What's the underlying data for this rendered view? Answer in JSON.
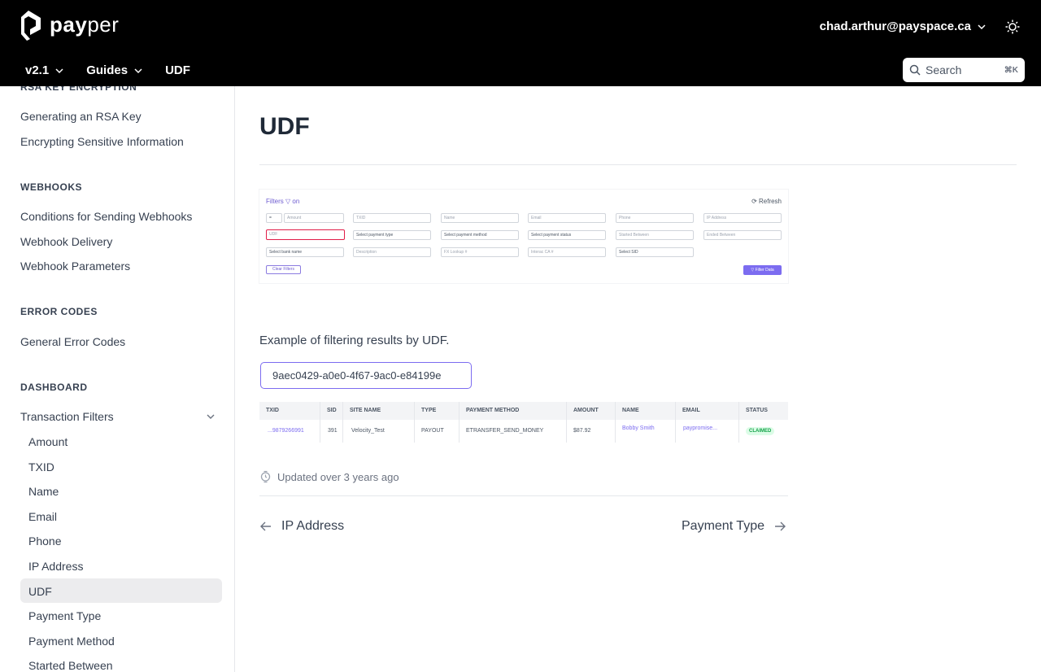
{
  "header": {
    "logo_text_bold": "pay",
    "logo_text_light": "per",
    "user_email": "chad.arthur@payspace.ca",
    "nav": [
      {
        "label": "v2.1"
      },
      {
        "label": "Guides"
      },
      {
        "label": "UDF"
      }
    ],
    "search_placeholder": "Search",
    "search_shortcut": "⌘K"
  },
  "sidebar": {
    "cut_section": "RSA KEY ENCRYPTION",
    "rsa_items": [
      "Generating an RSA Key",
      "Encrypting Sensitive Information"
    ],
    "webhooks_title": "WEBHOOKS",
    "webhooks_items": [
      "Conditions for Sending Webhooks",
      "Webhook Delivery",
      "Webhook Parameters"
    ],
    "errors_title": "ERROR CODES",
    "errors_items": [
      "General Error Codes"
    ],
    "dashboard_title": "DASHBOARD",
    "dashboard_group": "Transaction Filters",
    "filter_items": [
      "Amount",
      "TXID",
      "Name",
      "Email",
      "Phone",
      "IP Address",
      "UDF",
      "Payment Type",
      "Payment Method",
      "Started Between"
    ],
    "active_item": "UDF"
  },
  "main": {
    "title": "UDF",
    "filters_panel": {
      "title": "Filters ▽ on",
      "refresh": "⟳ Refresh",
      "op": "=",
      "row1": [
        "Amount",
        "TXID",
        "Name",
        "Email",
        "Phone",
        "IP Address"
      ],
      "row2": [
        "UDF",
        "Select payment type",
        "Select payment method",
        "Select payment status",
        "Started Between",
        "Ended Between"
      ],
      "row3": [
        "Select bank name",
        "Description",
        "FX Lookup #",
        "Interac CA #",
        "Select SID"
      ],
      "clear": "Clear Filters",
      "apply": "▽ Filter Data"
    },
    "caption": "Example of filtering results by UDF.",
    "udf_value": "9aec0429-a0e0-4f67-9ac0-e84199e",
    "table": {
      "headers": [
        "TXID",
        "SID",
        "SITE NAME",
        "TYPE",
        "PAYMENT METHOD",
        "AMOUNT",
        "NAME",
        "EMAIL",
        "STATUS"
      ],
      "row": [
        "...9879266991",
        "391",
        "Velocity_Test",
        "PAYOUT",
        "ETRANSFER_SEND_MONEY",
        "$87.92",
        "Bobby Smith",
        "paypromise...",
        "CLAIMED"
      ]
    },
    "updated": "Updated over 3 years ago",
    "prev_label": "IP Address",
    "next_label": "Payment Type"
  }
}
